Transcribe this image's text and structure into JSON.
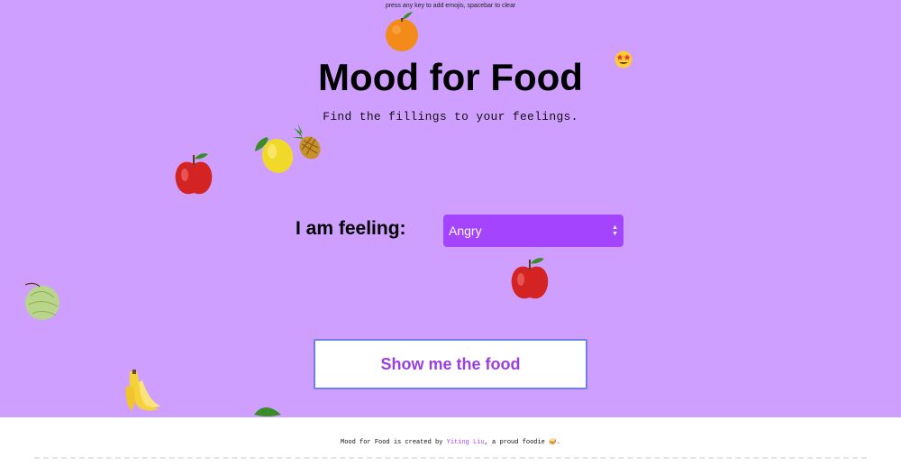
{
  "hint": "press any key to add emojis, spacebar to clear",
  "header": {
    "title": "Mood for Food",
    "subtitle": "Find the fillings to your feelings."
  },
  "form": {
    "feeling_label": "I am feeling:",
    "mood_selected": "Angry",
    "submit_label": "Show me the food"
  },
  "footer": {
    "prefix": "Mood for Food is created by ",
    "author": "Yiting Liu",
    "suffix": ", a proud foodie 🥪."
  },
  "colors": {
    "background": "#cf9fff",
    "accent": "#a444ff",
    "button_text": "#9b3ee0",
    "button_border": "#6f7fe6"
  },
  "decorations": [
    "orange-icon",
    "star-struck-emoji-icon",
    "lemon-icon",
    "pineapple-icon",
    "apple-icon",
    "apple-icon",
    "melon-icon",
    "banana-icon",
    "leaf-icon"
  ]
}
